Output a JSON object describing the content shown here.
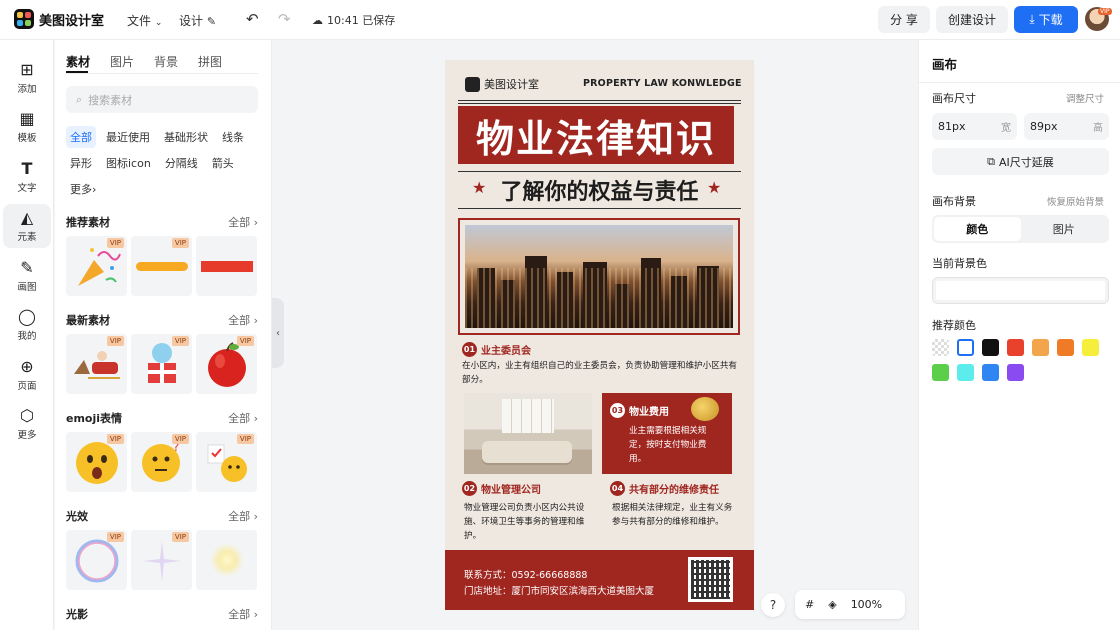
{
  "app": {
    "name": "美图设计室",
    "menu_file": "文件",
    "menu_design": "设计",
    "save_time": "10:41 已保存",
    "share": "分 享",
    "create": "创建设计",
    "download": "下载",
    "avatar_badge": "VIP"
  },
  "rail": [
    {
      "label": "添加",
      "icon": "plus-square-icon"
    },
    {
      "label": "模板",
      "icon": "template-icon"
    },
    {
      "label": "文字",
      "icon": "text-icon"
    },
    {
      "label": "元素",
      "icon": "shapes-icon"
    },
    {
      "label": "画图",
      "icon": "draw-icon"
    },
    {
      "label": "我的",
      "icon": "user-icon"
    },
    {
      "label": "页面",
      "icon": "page-add-icon"
    },
    {
      "label": "更多",
      "icon": "cube-icon"
    }
  ],
  "panel": {
    "tabs": [
      "素材",
      "图片",
      "背景",
      "拼图"
    ],
    "search_placeholder": "搜索素材",
    "tags": [
      "全部",
      "最近使用",
      "基础形状",
      "线条",
      "异形",
      "图标icon",
      "分隔线",
      "箭头",
      "更多"
    ],
    "all_label": "全部",
    "vip": "VIP",
    "sections": [
      {
        "title": "推荐素材",
        "items": [
          "party-popper",
          "yellow-brush-stroke",
          "red-rectangle"
        ]
      },
      {
        "title": "最新素材",
        "items": [
          "santa-sleigh",
          "christmas-gift",
          "red-apple"
        ]
      },
      {
        "title": "emoji表情",
        "items": [
          "shocked-emoji",
          "thinking-emoji",
          "chick-emoji"
        ]
      },
      {
        "title": "光效",
        "items": [
          "bubble-ring",
          "sparkle",
          "glow"
        ]
      },
      {
        "title": "光影",
        "items": []
      }
    ]
  },
  "poster": {
    "logo_text": "美图设计室",
    "english_title": "PROPERTY LAW KONWLEDGE",
    "title": "物业法律知识",
    "subtitle": "了解你的权益与责任",
    "sections": [
      {
        "num": "01",
        "title": "业主委员会",
        "text": "在小区内，业主有组织自己的业主委员会，负责协助管理和维护小区共有部分。"
      },
      {
        "num": "02",
        "title": "物业管理公司",
        "text": "物业管理公司负责小区内公共设施、环境卫生等事务的管理和维护。"
      },
      {
        "num": "03",
        "title": "物业费用",
        "text": "业主需要根据相关规定，按时支付物业费用。"
      },
      {
        "num": "04",
        "title": "共有部分的维修责任",
        "text": "根据相关法律规定，业主有义务参与共有部分的维修和维护。"
      }
    ],
    "contact": "联系方式：0592-66668888",
    "address": "门店地址：厦门市同安区滨海西大道美图大厦"
  },
  "zoom": {
    "help": "?",
    "level": "100%"
  },
  "right": {
    "title": "画布",
    "size_label": "画布尺寸",
    "adjust_size": "调整尺寸",
    "width_value": "81px",
    "width_unit": "宽",
    "height_value": "89px",
    "height_unit": "高",
    "ai_expand": "AI尺寸延展",
    "bg_label": "画布背景",
    "restore_bg": "恢复原始背景",
    "seg_color": "颜色",
    "seg_image": "图片",
    "current_bg": "当前背景色",
    "recommend": "推荐颜色",
    "swatches": [
      "transparent",
      "#ffffff",
      "#111111",
      "#e8412c",
      "#f2a54a",
      "#ef7b27",
      "#f5ee3b",
      "#5ccf4a",
      "#5cecec",
      "#2f86f2",
      "#8a4cf0"
    ]
  },
  "colors": {
    "accent": "#1f6ff5",
    "poster_red": "#a02620",
    "poster_bg": "#efe8e0"
  }
}
